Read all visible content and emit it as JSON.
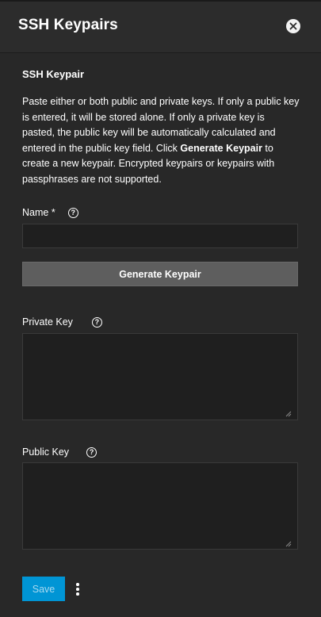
{
  "header": {
    "title": "SSH Keypairs",
    "close_icon": "close-circle-icon"
  },
  "section": {
    "title": "SSH Keypair",
    "description_part1": "Paste either or both public and private keys. If only a public key is entered, it will be stored alone. If only a private key is pasted, the public key will be automatically calculated and entered in the public key field. Click ",
    "description_bold": "Generate Keypair",
    "description_part2": " to create a new keypair. Encrypted keypairs or keypairs with passphrases are not supported."
  },
  "fields": {
    "name": {
      "label": "Name *",
      "value": "",
      "help_glyph": "?"
    },
    "generate_label": "Generate Keypair",
    "private_key": {
      "label": "Private Key",
      "value": "",
      "help_glyph": "?"
    },
    "public_key": {
      "label": "Public Key",
      "value": "",
      "help_glyph": "?"
    }
  },
  "actions": {
    "save_label": "Save",
    "more_icon": "more-vertical-icon"
  },
  "colors": {
    "background": "#282828",
    "header": "#2c2c2c",
    "primary": "#0095d5",
    "button": "#5e5e5e"
  }
}
